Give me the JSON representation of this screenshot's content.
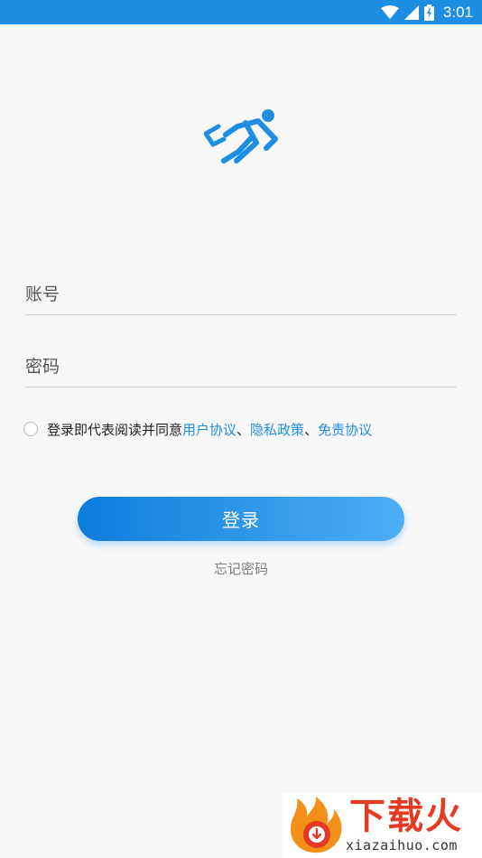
{
  "status_bar": {
    "time": "3:01",
    "icons": [
      "wifi-icon",
      "signal-icon",
      "battery-icon"
    ],
    "color": "#1e8ee3"
  },
  "app": {
    "logo_icon": "runner-logo-icon",
    "accent": "#1e8ee3"
  },
  "login_form": {
    "account_placeholder": "账号",
    "password_placeholder": "密码",
    "agreement": {
      "prefix": "登录即代表阅读并同意",
      "user_agreement": "用户协议",
      "separator1": "、",
      "privacy_policy": "隐私政策",
      "separator2": "、",
      "disclaimer": "免责协议",
      "checked": false
    },
    "login_label": "登录",
    "forgot_password": "忘记密码"
  },
  "watermark": {
    "title": "下载火",
    "domain": "xiazaihuo.com",
    "brand_color": "#e53a23"
  }
}
